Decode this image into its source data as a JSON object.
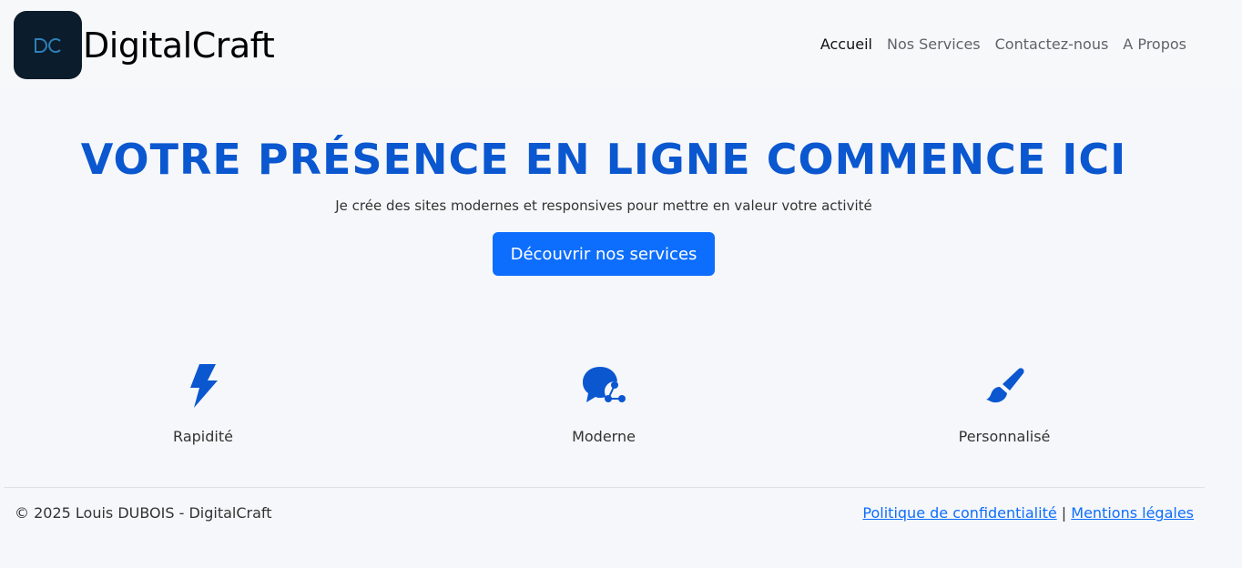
{
  "header": {
    "logo_letters": "DC",
    "brand": "DigitalCraft",
    "nav": [
      {
        "label": "Accueil"
      },
      {
        "label": "Nos Services"
      },
      {
        "label": "Contactez-nous"
      },
      {
        "label": "A Propos"
      }
    ]
  },
  "hero": {
    "title": "VOTRE PRÉSENCE EN LIGNE COMMENCE ICI",
    "subtitle": "Je crée des sites modernes et responsives pour mettre en valeur votre activité",
    "cta_label": "Découvrir nos services"
  },
  "features": [
    {
      "icon": "lightning-icon",
      "label": "Rapidité"
    },
    {
      "icon": "chat-share-icon",
      "label": "Moderne"
    },
    {
      "icon": "paintbrush-icon",
      "label": "Personnalisé"
    }
  ],
  "footer": {
    "copyright": "© 2025 Louis DUBOIS - DigitalCraft",
    "privacy": "Politique de confidentialité",
    "separator": "|",
    "legal": "Mentions légales"
  },
  "colors": {
    "accent": "#0a57d0",
    "button": "#0d6efd",
    "logo_bg": "#0b1c2c"
  }
}
